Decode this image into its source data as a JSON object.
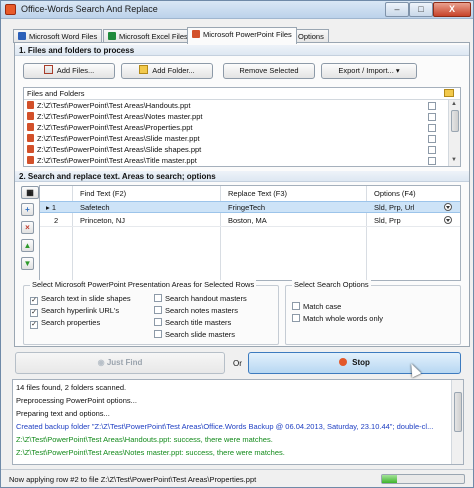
{
  "window": {
    "title": "Office-Words Search And Replace",
    "min_label": "–",
    "max_label": "□",
    "close_label": "X"
  },
  "tabs": [
    {
      "label": "Microsoft Word Files",
      "icon": "word-icon"
    },
    {
      "label": "Microsoft Excel Files",
      "icon": "excel-icon"
    },
    {
      "label": "Microsoft PowerPoint Files",
      "icon": "powerpoint-icon"
    },
    {
      "label": "Options",
      "icon": ""
    }
  ],
  "files_section": {
    "title": "1. Files and folders to process",
    "add_files_label": "Add Files...",
    "add_folder_label": "Add Folder...",
    "remove_selected_label": "Remove Selected",
    "export_import_label": "Export / Import...",
    "list_header": "Files and Folders",
    "files": [
      "Z:\\Z\\Test\\PowerPoint\\Test Areas\\Handouts.ppt",
      "Z:\\Z\\Test\\PowerPoint\\Test Areas\\Notes master.ppt",
      "Z:\\Z\\Test\\PowerPoint\\Test Areas\\Properties.ppt",
      "Z:\\Z\\Test\\PowerPoint\\Test Areas\\Slide master.ppt",
      "Z:\\Z\\Test\\PowerPoint\\Test Areas\\Slide shapes.ppt",
      "Z:\\Z\\Test\\PowerPoint\\Test Areas\\Title master.ppt"
    ]
  },
  "replace_section": {
    "title": "2. Search and replace text. Areas to search; options",
    "columns": [
      "Find Text (F2)",
      "Replace Text (F3)",
      "Options (F4)"
    ],
    "rows": [
      {
        "num": "1",
        "find": "Safetech",
        "replace": "FringeTech",
        "options": "Sld, Prp, Url"
      },
      {
        "num": "2",
        "find": "Princeton, NJ",
        "replace": "Boston, MA",
        "options": "Sld, Prp"
      }
    ]
  },
  "areas_group": {
    "title": "Select Microsoft PowerPoint Presentation Areas for Selected Rows",
    "left": [
      {
        "label": "Search text in slide shapes",
        "checked": true
      },
      {
        "label": "Search hyperlink URL's",
        "checked": true
      },
      {
        "label": "Search properties",
        "checked": true
      }
    ],
    "right": [
      {
        "label": "Search handout masters",
        "checked": false
      },
      {
        "label": "Search notes masters",
        "checked": false
      },
      {
        "label": "Search title masters",
        "checked": false
      },
      {
        "label": "Search slide masters",
        "checked": false
      }
    ]
  },
  "search_options": {
    "title": "Select Search Options",
    "items": [
      {
        "label": "Match case",
        "checked": false
      },
      {
        "label": "Match whole words only",
        "checked": false
      }
    ]
  },
  "actions": {
    "just_find_label": "Just Find",
    "or_label": "Or",
    "stop_label": "Stop"
  },
  "log": {
    "lines": [
      {
        "text": "14 files found, 2 folders scanned.",
        "color": "#111111"
      },
      {
        "text": "Preprocessing PowerPoint options...",
        "color": "#111111"
      },
      {
        "text": "Preparing text and options...",
        "color": "#111111"
      },
      {
        "text": "Created backup folder \"Z:\\Z\\Test\\PowerPoint\\Test Areas\\Office.Words Backup @ 06.04.2013, Saturday, 23.10.44\"; double-cl...",
        "color": "#1f3fc2"
      },
      {
        "text": "Z:\\Z\\Test\\PowerPoint\\Test Areas\\Handouts.ppt: success, there were matches.",
        "color": "#138a1b"
      },
      {
        "text": "Z:\\Z\\Test\\PowerPoint\\Test Areas\\Notes master.ppt: success, there were matches.",
        "color": "#138a1b"
      }
    ]
  },
  "status": {
    "text": "Now applying row #2 to file Z:\\Z\\Test\\PowerPoint\\Test Areas\\Properties.ppt",
    "progress_fraction": 0.18
  }
}
